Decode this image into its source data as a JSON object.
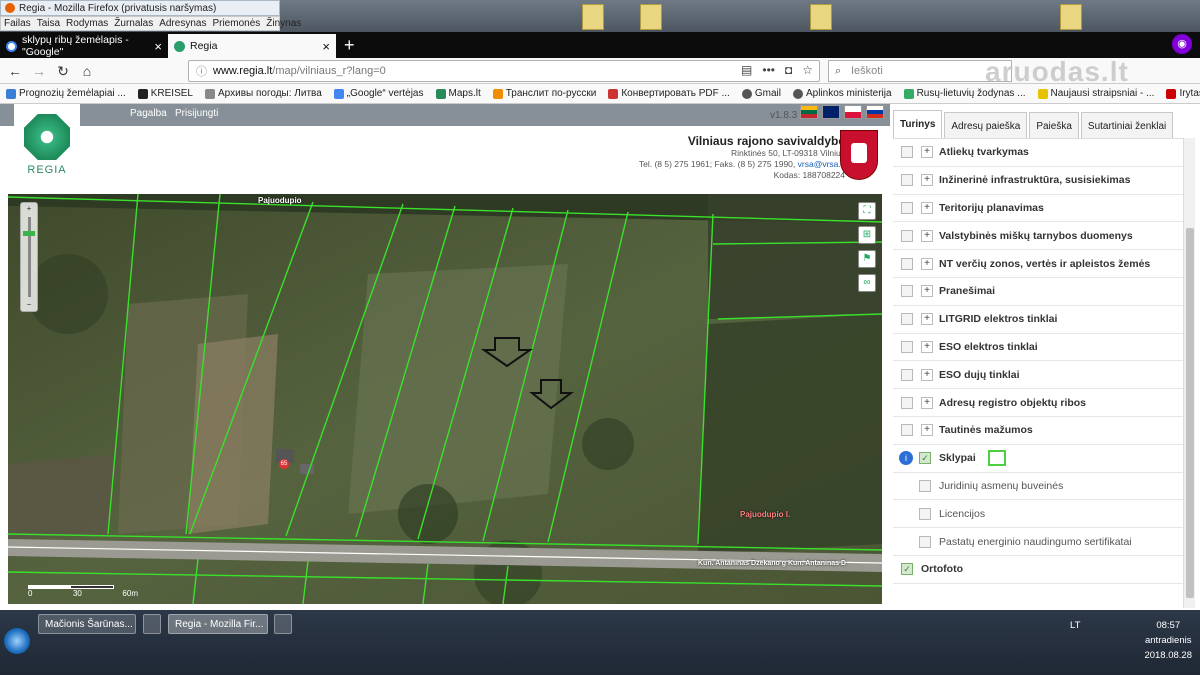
{
  "window": {
    "title": "Regia - Mozilla Firefox (privatusis naršymas)",
    "menu": [
      "Failas",
      "Taisa",
      "Rodymas",
      "Žurnalas",
      "Adresynas",
      "Priemonės",
      "Žinynas"
    ]
  },
  "tabs": [
    {
      "label": "sklypų ribų žemėlapis - \"Google\"",
      "active": false
    },
    {
      "label": "Regia",
      "active": true
    }
  ],
  "newtab_label": "+",
  "url": {
    "host": "www.regia.lt",
    "path": "/map/vilniaus_r?lang=0"
  },
  "search": {
    "placeholder": "Ieškoti"
  },
  "watermark": "aruodas.lt",
  "bookmarks": [
    "Prognozių žemėlapiai ...",
    "KREISEL",
    "Архивы погоды: Литва",
    "„Google“ vertėjas",
    "Maps.lt",
    "Транслит по-русски",
    "Конвертировать PDF ...",
    "Gmail",
    "Aplinkos ministerija",
    "Rusų-lietuvių žodynas ...",
    "Naujausi straipsniai - ...",
    "Irytas.lt / Naujienos"
  ],
  "header": {
    "links": [
      "Pagalba",
      "Prisijungti"
    ],
    "version": "v1.8.3",
    "logo": "REGIA"
  },
  "municipality": {
    "name": "Vilniaus rajono savivaldybė",
    "address": "Rinktinės 50, LT-09318 Vilnius",
    "phone": "Tel. (8 5) 275 1961; Faks. (8 5) 275 1990, ",
    "email": "vrsa@vrsa.lt",
    "code": "Kodas: 188708224"
  },
  "map": {
    "labels": {
      "stream": "Pajuodupio",
      "stream_right": "Pajuodupio l.",
      "road": "Kun. Antaninas Dzekano g Kun. Antaninas D",
      "parcel": "65"
    },
    "scale": [
      "0",
      "30",
      "60m"
    ]
  },
  "panel": {
    "tabs": [
      "Turinys",
      "Adresų paieška",
      "Paieška",
      "Sutartiniai ženklai"
    ],
    "layers": [
      {
        "name": "Atliekų tvarkymas",
        "checked": false,
        "expand": true,
        "sub": false
      },
      {
        "name": "Inžinerinė infrastruktūra, susisiekimas",
        "checked": false,
        "expand": true,
        "sub": false
      },
      {
        "name": "Teritorijų planavimas",
        "checked": false,
        "expand": true,
        "sub": false
      },
      {
        "name": "Valstybinės miškų tarnybos duomenys",
        "checked": false,
        "expand": true,
        "sub": false
      },
      {
        "name": "NT verčių zonos, vertės ir apleistos žemės",
        "checked": false,
        "expand": true,
        "sub": false
      },
      {
        "name": "Pranešimai",
        "checked": false,
        "expand": true,
        "sub": false
      },
      {
        "name": "LITGRID elektros tinklai",
        "checked": false,
        "expand": true,
        "sub": false
      },
      {
        "name": "ESO elektros tinklai",
        "checked": false,
        "expand": true,
        "sub": false
      },
      {
        "name": "ESO dujų tinklai",
        "checked": false,
        "expand": true,
        "sub": false
      },
      {
        "name": "Adresų registro objektų ribos",
        "checked": false,
        "expand": true,
        "sub": false
      },
      {
        "name": "Tautinės mažumos",
        "checked": false,
        "expand": true,
        "sub": false
      },
      {
        "name": "Sklypai",
        "checked": true,
        "expand": false,
        "sub": false,
        "info": true,
        "legend": true
      },
      {
        "name": "Juridinių asmenų buveinės",
        "checked": false,
        "expand": false,
        "sub": true
      },
      {
        "name": "Licencijos",
        "checked": false,
        "expand": false,
        "sub": true
      },
      {
        "name": "Pastatų energinio naudingumo sertifikatai",
        "checked": false,
        "expand": false,
        "sub": true
      },
      {
        "name": "Ortofoto",
        "checked": true,
        "expand": false,
        "sub": false
      }
    ]
  },
  "taskbar": {
    "buttons": [
      "Mačionis Šarūnas...",
      "Regia - Mozilla Fir..."
    ],
    "lang": "LT",
    "time": "08:57",
    "day": "antradienis",
    "date": "2018.08.28"
  }
}
